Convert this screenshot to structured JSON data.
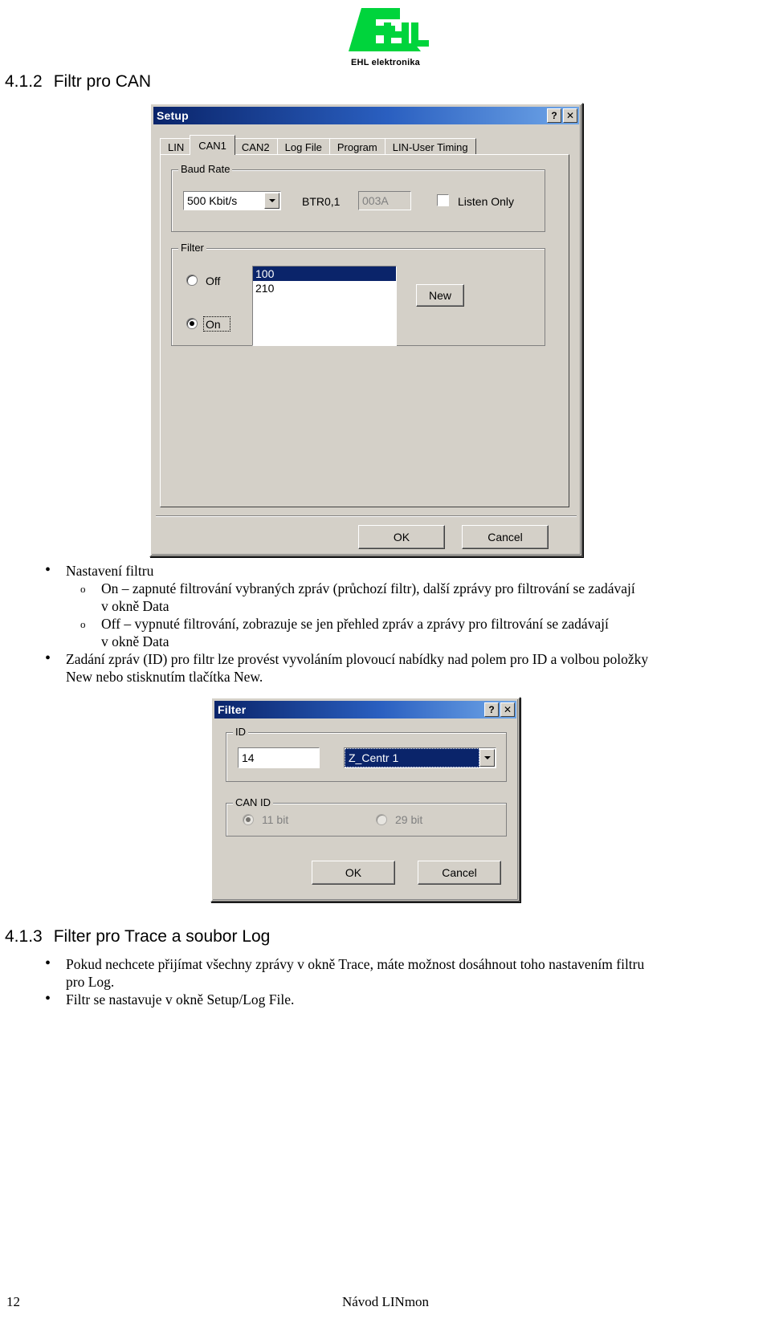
{
  "logo": {
    "mark_text": "EHL",
    "caption": "EHL elektronika",
    "color": "#00d43c"
  },
  "section_1": {
    "number": "4.1.2",
    "title": "Filtr pro CAN"
  },
  "setup_dialog": {
    "title": "Setup",
    "help_button": "?",
    "close_button": "✕",
    "tabs": [
      {
        "label": "LIN",
        "active": false
      },
      {
        "label": "CAN1",
        "active": true
      },
      {
        "label": "CAN2",
        "active": false
      },
      {
        "label": "Log File",
        "active": false
      },
      {
        "label": "Program",
        "active": false
      },
      {
        "label": "LIN-User Timing",
        "active": false
      }
    ],
    "baud_rate": {
      "group_title": "Baud Rate",
      "combo_value": "500 Kbit/s",
      "btr_label": "BTR0,1",
      "btr_value": "003A",
      "listen_only_label": "Listen Only",
      "listen_only_checked": false
    },
    "filter": {
      "group_title": "Filter",
      "radio_off_label": "Off",
      "radio_on_label": "On",
      "selected": "On",
      "items": [
        "100",
        "210"
      ],
      "selected_item": "100",
      "new_button": "New"
    },
    "ok_button": "OK",
    "cancel_button": "Cancel"
  },
  "body_text": {
    "lead": "Nastavení filtru",
    "bullets": [
      {
        "mark": "o",
        "lines": [
          "On – zapnuté filtrování vybraných zpráv (průchozí filtr), další zprávy pro filtrování se zadávají",
          "v okně Data"
        ]
      },
      {
        "mark": "o",
        "lines": [
          "Off – vypnuté filtrování, zobrazuje se jen přehled zpráv a zprávy pro filtrování se zadávají",
          "v okně Data"
        ]
      }
    ],
    "paragraph_id": [
      "Zadání zpráv (ID) pro filtr lze provést vyvoláním plovoucí nabídky nad polem pro ID a volbou položky",
      "New nebo stisknutím tlačítka New."
    ]
  },
  "filter_dialog": {
    "title": "Filter",
    "help_button": "?",
    "close_button": "✕",
    "id_group": {
      "group_title": "ID",
      "id_value": "14",
      "name_value": "Z_Centr 1"
    },
    "can_id_group": {
      "group_title": "CAN ID",
      "option_11bit": "11 bit",
      "option_29bit": "29 bit",
      "selected": "11 bit",
      "disabled": true
    },
    "ok_button": "OK",
    "cancel_button": "Cancel"
  },
  "section_2": {
    "number": "4.1.3",
    "title": "Filter pro Trace a soubor Log",
    "bullets": [
      {
        "mark": "•",
        "lines": [
          "Pokud nechcete přijímat všechny zprávy v okně Trace, máte možnost dosáhnout toho nastavením filtru",
          "pro Log."
        ]
      },
      {
        "mark": "•",
        "lines": [
          "Filtr se nastavuje v okně Setup/Log File."
        ]
      }
    ]
  },
  "footer": {
    "page_number": "12",
    "document_title": "Návod LINmon"
  }
}
